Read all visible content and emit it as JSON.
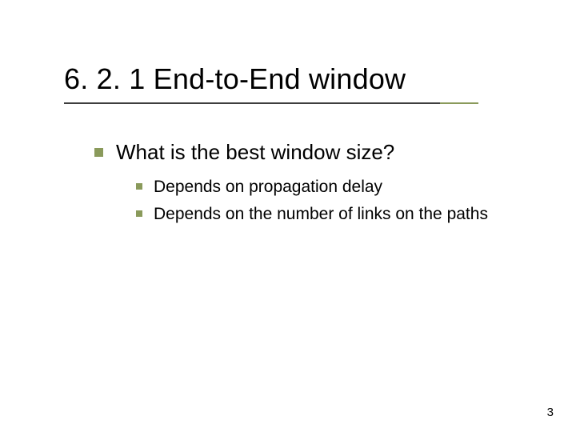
{
  "slide": {
    "title": "6. 2. 1 End-to-End window",
    "level1": {
      "text": "What is the best window size?"
    },
    "level2": [
      {
        "text": "Depends on propagation delay"
      },
      {
        "text": "Depends on the number of links on the paths"
      }
    ],
    "page_number": "3"
  }
}
